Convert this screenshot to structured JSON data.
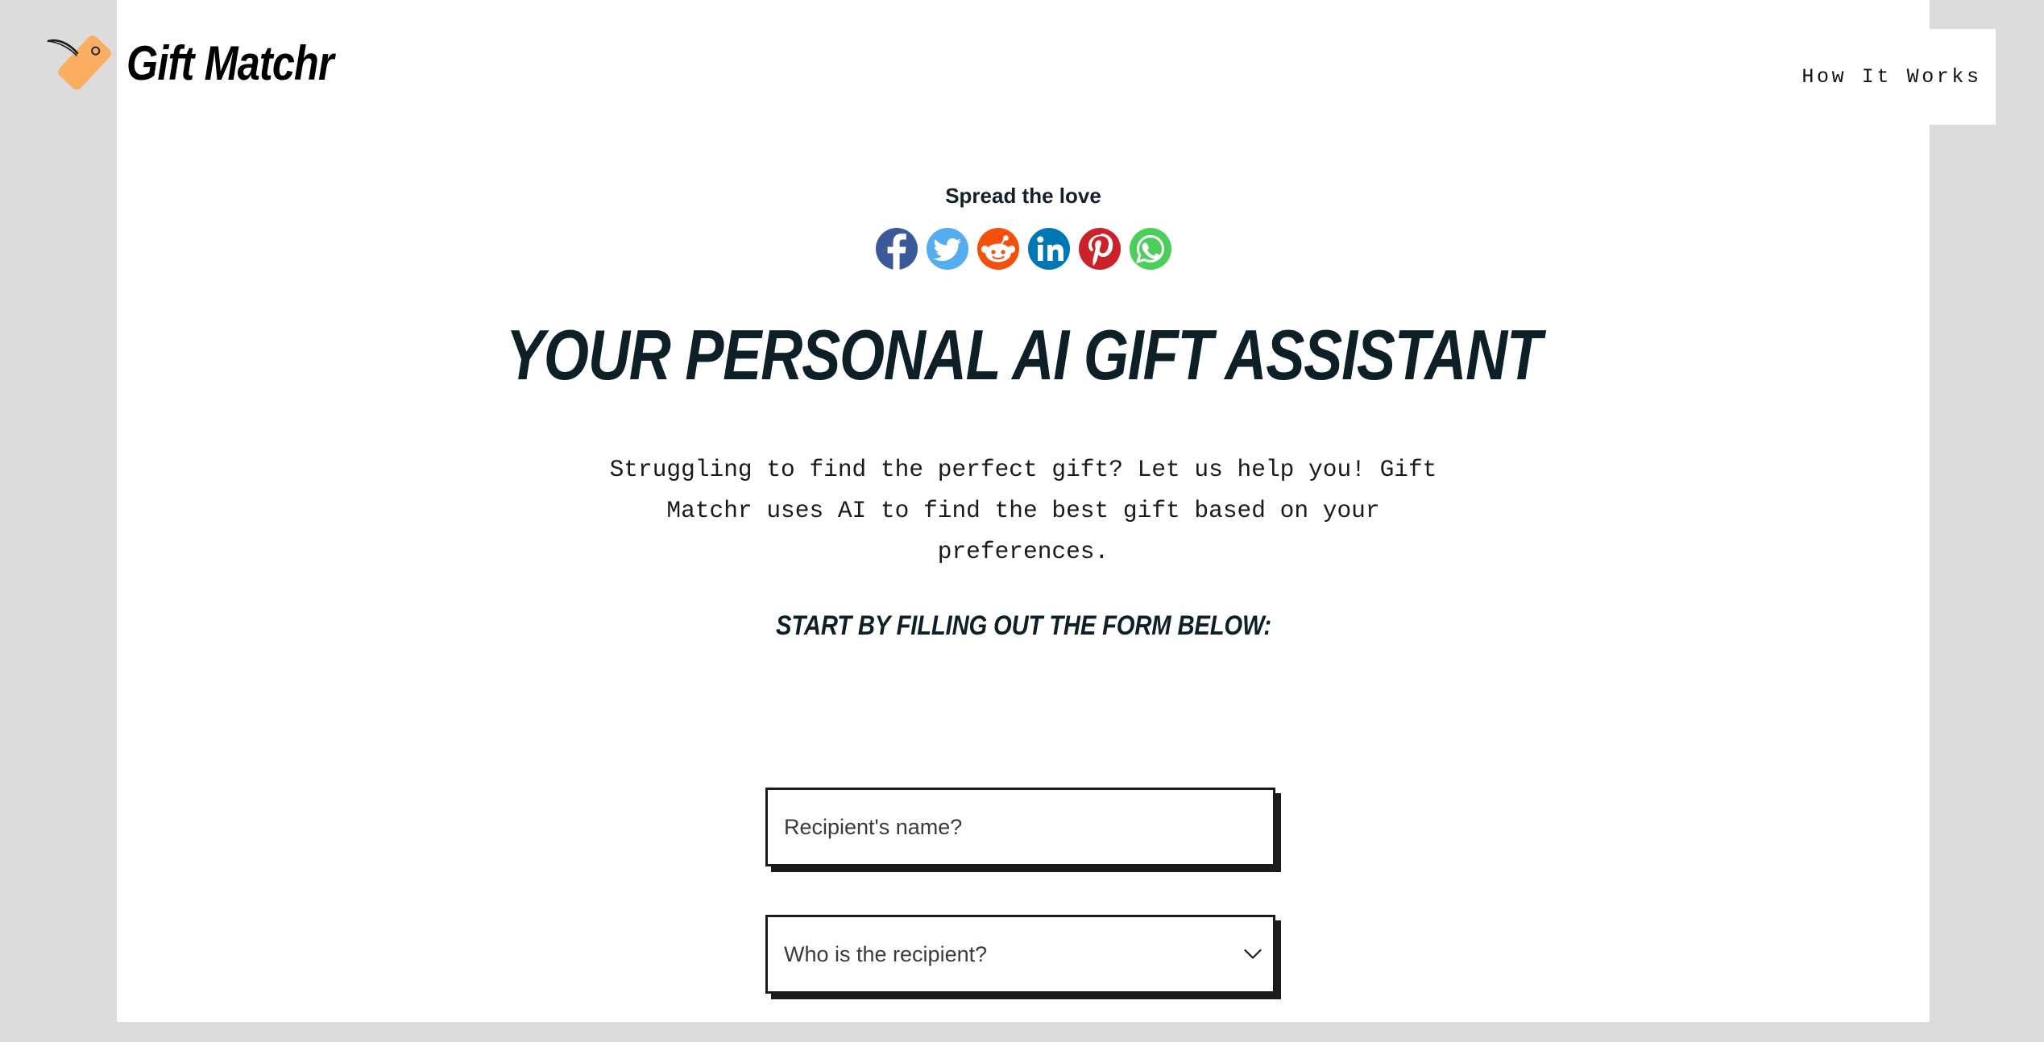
{
  "brand": {
    "name": "Gift Matchr",
    "icon": "price-tag-icon",
    "tag_color": "#FBAE62",
    "word_color": "#000000"
  },
  "nav": {
    "items": [
      {
        "label": "How It Works",
        "name": "how-it-works"
      }
    ]
  },
  "share": {
    "label": "Spread the love",
    "buttons": [
      {
        "name": "facebook",
        "label": "Facebook",
        "color": "#3b5998"
      },
      {
        "name": "twitter",
        "label": "Twitter",
        "color": "#55acee"
      },
      {
        "name": "reddit",
        "label": "Reddit",
        "color": "#f4500a"
      },
      {
        "name": "linkedin",
        "label": "LinkedIn",
        "color": "#0077b5"
      },
      {
        "name": "pinterest",
        "label": "Pinterest",
        "color": "#cb2128"
      },
      {
        "name": "whatsapp",
        "label": "WhatsApp",
        "color": "#4ccf5a"
      }
    ]
  },
  "hero": {
    "title": "YOUR PERSONAL AI GIFT ASSISTANT",
    "title_color": "#0d2028",
    "paragraph": "Struggling to find the perfect gift? Let us help you! Gift Matchr uses AI to find the best gift based on your preferences.",
    "kicker": "START BY FILLING OUT THE FORM BELOW:"
  },
  "form": {
    "fields": [
      {
        "name": "recipient-name",
        "type": "text",
        "placeholder": "Recipient's name?",
        "value": ""
      },
      {
        "name": "recipient-relation",
        "type": "select",
        "placeholder": "Who is the recipient?",
        "selected": "Who is the recipient?",
        "chevron": "chevron-down-icon"
      }
    ]
  },
  "theme": {
    "page_background": "#dcdcdc",
    "sheet_background": "#ffffff",
    "border": "#1b1b1b"
  }
}
